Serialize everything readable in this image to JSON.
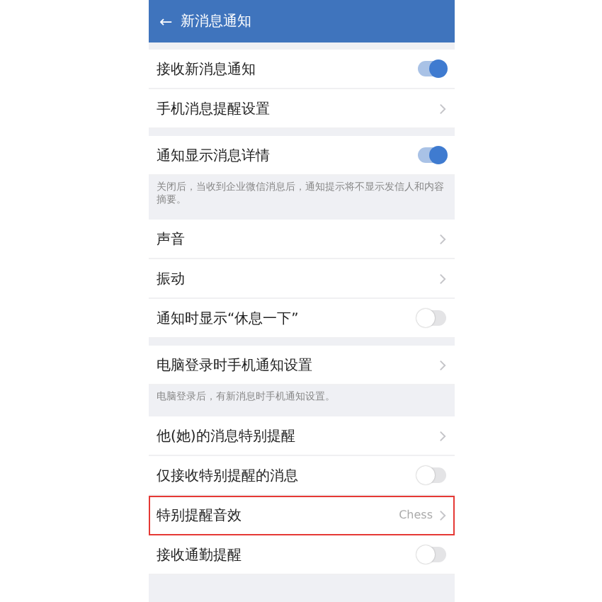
{
  "header": {
    "back": "←",
    "title": "新消息通知"
  },
  "groups": [
    {
      "rows": [
        {
          "kind": "toggle",
          "label": "接收新消息通知",
          "on": true,
          "outlined": false
        },
        {
          "kind": "link",
          "label": "手机消息提醒设置",
          "outlined": false
        }
      ]
    },
    {
      "rows": [
        {
          "kind": "toggle",
          "label": "通知显示消息详情",
          "on": true,
          "outlined": false
        }
      ],
      "note": "关闭后，当收到企业微信消息后，通知提示将不显示发信人和内容摘要。"
    },
    {
      "rows": [
        {
          "kind": "link",
          "label": "声音",
          "outlined": false
        },
        {
          "kind": "link",
          "label": "振动",
          "outlined": false
        },
        {
          "kind": "toggle",
          "label": "通知时显示“休息一下”",
          "on": false,
          "outlined": false
        }
      ]
    },
    {
      "rows": [
        {
          "kind": "link",
          "label": "电脑登录时手机通知设置",
          "outlined": false
        }
      ],
      "note": "电脑登录后，有新消息时手机通知设置。"
    },
    {
      "rows": [
        {
          "kind": "link",
          "label": "他(她)的消息特别提醒",
          "outlined": false
        },
        {
          "kind": "toggle",
          "label": "仅接收特别提醒的消息",
          "on": false,
          "outlined": false
        },
        {
          "kind": "link",
          "label": "特别提醒音效",
          "value": "Chess",
          "outlined": true
        },
        {
          "kind": "toggle",
          "label": "接收通勤提醒",
          "on": false,
          "outlined": false
        }
      ]
    }
  ]
}
